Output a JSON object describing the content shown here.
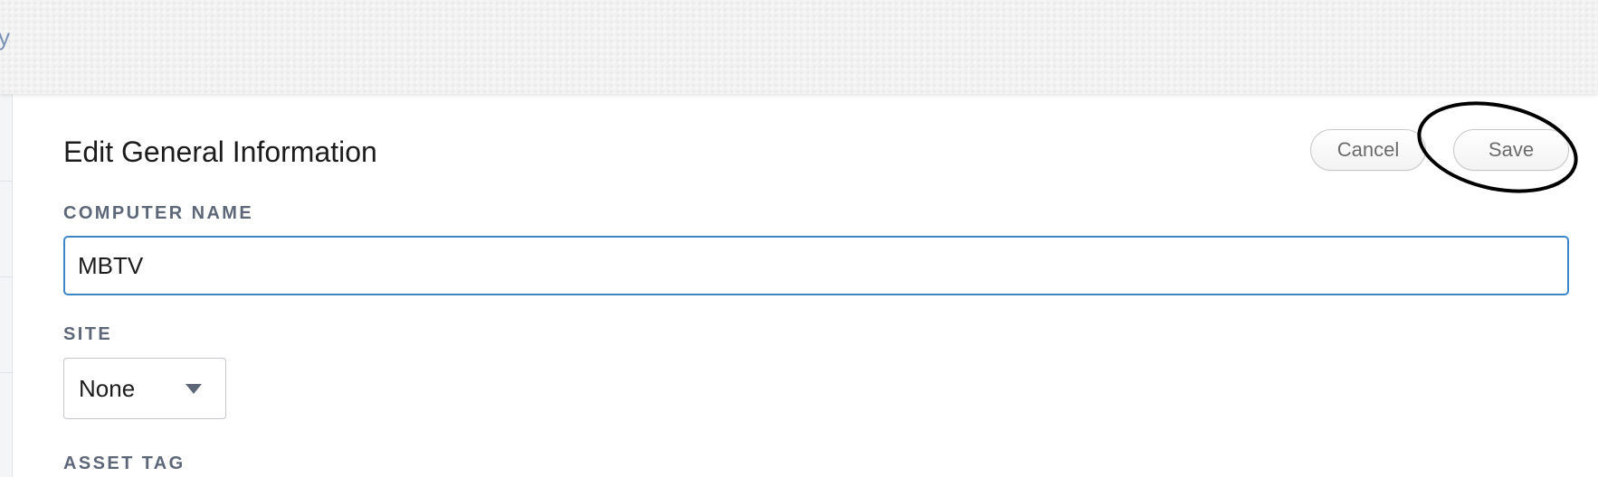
{
  "header": {
    "breadcrumb_fragment": "y"
  },
  "panel": {
    "title": "Edit General Information",
    "cancel_label": "Cancel",
    "save_label": "Save"
  },
  "form": {
    "computer_name": {
      "label": "COMPUTER NAME",
      "value": "MBTV"
    },
    "site": {
      "label": "SITE",
      "selected": "None"
    },
    "asset_tag": {
      "label": "ASSET TAG"
    }
  },
  "icons": {
    "site_dropdown": "chevron-down-icon"
  },
  "colors": {
    "focus_border": "#3c86c8",
    "label_text": "#5d6778",
    "annotation": "#000000"
  }
}
